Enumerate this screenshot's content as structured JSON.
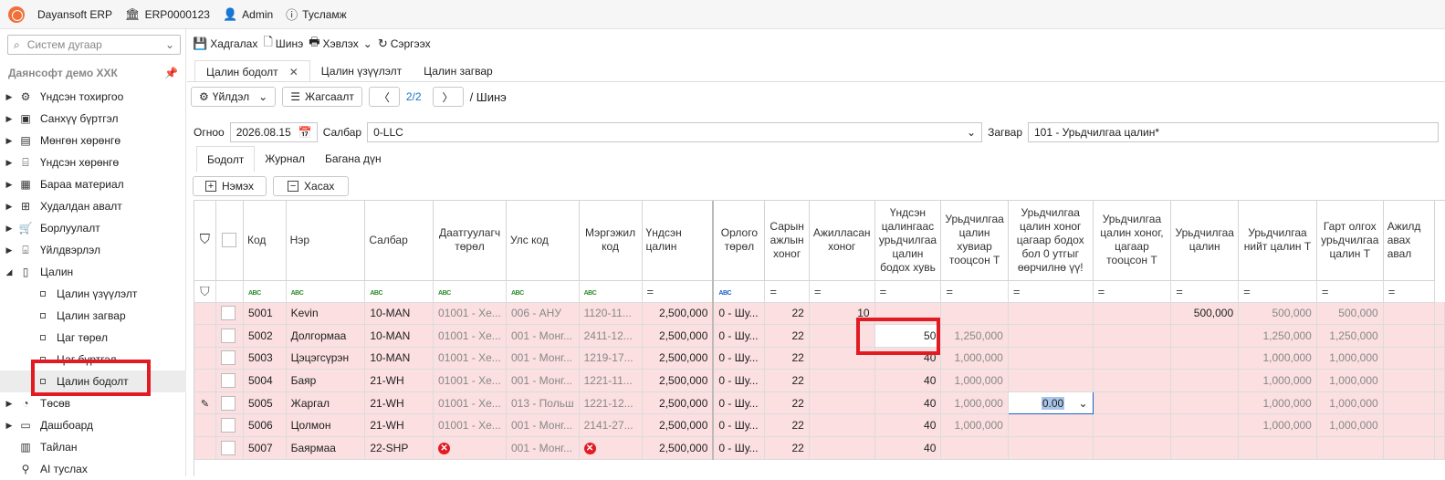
{
  "topbar": {
    "app": "Dayansoft ERP",
    "code": "ERP0000123",
    "user": "Admin",
    "help": "Тусламж"
  },
  "sidebar": {
    "search_placeholder": "Систем дугаар",
    "company": "Даянсофт демо ХХК",
    "items": [
      {
        "label": "Үндсэн тохиргоо",
        "icon": "gear-icon",
        "arrow": "▶"
      },
      {
        "label": "Санхүү бүртгэл",
        "icon": "ledger-icon",
        "arrow": "▶"
      },
      {
        "label": "Мөнгөн хөрөнгө",
        "icon": "cash-icon",
        "arrow": "▶"
      },
      {
        "label": "Үндсэн хөрөнгө",
        "icon": "asset-icon",
        "arrow": "▶"
      },
      {
        "label": "Бараа материал",
        "icon": "box-icon",
        "arrow": "▶"
      },
      {
        "label": "Худалдан авалт",
        "icon": "cart-icon",
        "arrow": "▶"
      },
      {
        "label": "Борлуулалт",
        "icon": "sales-icon",
        "arrow": "▶"
      },
      {
        "label": "Үйлдвэрлэл",
        "icon": "factory-icon",
        "arrow": "▶"
      },
      {
        "label": "Цалин",
        "icon": "document-icon",
        "arrow": "◢"
      }
    ],
    "sub_items": [
      "Цалин үзүүлэлт",
      "Цалин загвар",
      "Цаг төрөл",
      "Цаг бүртгэл",
      "Цалин бодолт"
    ],
    "bottom_items": [
      {
        "label": "Төсөв",
        "icon": "pie-icon",
        "arrow": "▶"
      },
      {
        "label": "Дашбоард",
        "icon": "dashboard-icon",
        "arrow": "▶"
      },
      {
        "label": "Тайлан",
        "icon": "report-icon",
        "arrow": ""
      },
      {
        "label": "AI туслах",
        "icon": "ai-icon",
        "arrow": ""
      }
    ]
  },
  "toolbar": {
    "save": "Хадгалах",
    "new": "Шинэ",
    "print": "Хэвлэх",
    "refresh": "Сэргээх"
  },
  "tabs": [
    "Цалин бодолт",
    "Цалин үзүүлэлт",
    "Цалин загвар"
  ],
  "nav": {
    "actions": "Үйлдэл",
    "list": "Жагсаалт",
    "page": "2/2",
    "crumb": "/ Шинэ"
  },
  "form": {
    "date_label": "Огноо",
    "date": "2026.08.15",
    "branch_label": "Салбар",
    "branch": "0-LLC",
    "template_label": "Загвар",
    "template": "101 - Урьдчилгаа цалин*"
  },
  "subtabs": [
    "Бодолт",
    "Журнал",
    "Багана дүн"
  ],
  "grid_actions": {
    "add": "Нэмэх",
    "remove": "Хасах"
  },
  "columns": [
    "Код",
    "Нэр",
    "Салбар",
    "Даатгуулагч төрөл",
    "Улс код",
    "Мэргэжил код",
    "Үндсэн цалин",
    "Орлого төрөл",
    "Сарын ажлын хоног",
    "Ажилласан хоног",
    "Үндсэн цалингаас урьдчилгаа цалин бодох хувь",
    "Урьдчилгаа цалин хувиар тооцсон Т",
    "Урьдчилгаа цалин хоног цагаар бодох бол 0 утгыг өөрчилнө үү!",
    "Урьдчилгаа цалин хоног, цагаар тооцсон Т",
    "Урьдчилгаа цалин",
    "Урьдчилгаа нийт цалин Т",
    "Гарт олгох урьдчилгаа цалин Т",
    "Ажилд авах авал"
  ],
  "filter_icon_text": "ABC",
  "filter_eq": "=",
  "rows": [
    {
      "code": "5001",
      "name": "Kevin",
      "branch": "10-MAN",
      "ins": "01001 - Хе...",
      "country": "006 - АНУ",
      "prof": "1120-11...",
      "base": "2,500,000",
      "income": "0 - Шу...",
      "days": "22",
      "worked": "10",
      "pct": "",
      "pctamt": "",
      "hours": "",
      "hoursamt": "",
      "adv": "500,000",
      "total": "500,000",
      "hand": "500,000",
      "hire": ""
    },
    {
      "code": "5002",
      "name": "Долгормаа",
      "branch": "10-MAN",
      "ins": "01001 - Хе...",
      "country": "001 - Монг...",
      "prof": "2411-12...",
      "base": "2,500,000",
      "income": "0 - Шу...",
      "days": "22",
      "worked": "",
      "pct": "50",
      "pctamt": "1,250,000",
      "hours": "",
      "hoursamt": "",
      "adv": "",
      "total": "1,250,000",
      "hand": "1,250,000",
      "hire": ""
    },
    {
      "code": "5003",
      "name": "Цэцэгсүрэн",
      "branch": "10-MAN",
      "ins": "01001 - Хе...",
      "country": "001 - Монг...",
      "prof": "1219-17...",
      "base": "2,500,000",
      "income": "0 - Шу...",
      "days": "22",
      "worked": "",
      "pct": "40",
      "pctamt": "1,000,000",
      "hours": "",
      "hoursamt": "",
      "adv": "",
      "total": "1,000,000",
      "hand": "1,000,000",
      "hire": ""
    },
    {
      "code": "5004",
      "name": "Баяр",
      "branch": "21-WH",
      "ins": "01001 - Хе...",
      "country": "001 - Монг...",
      "prof": "1221-11...",
      "base": "2,500,000",
      "income": "0 - Шу...",
      "days": "22",
      "worked": "",
      "pct": "40",
      "pctamt": "1,000,000",
      "hours": "",
      "hoursamt": "",
      "adv": "",
      "total": "1,000,000",
      "hand": "1,000,000",
      "hire": ""
    },
    {
      "code": "5005",
      "name": "Жаргал",
      "branch": "21-WH",
      "ins": "01001 - Хе...",
      "country": "013 - Польш",
      "prof": "1221-12...",
      "base": "2,500,000",
      "income": "0 - Шу...",
      "days": "22",
      "worked": "",
      "pct": "40",
      "pctamt": "1,000,000",
      "hours": "0.00",
      "hoursamt": "",
      "adv": "",
      "total": "1,000,000",
      "hand": "1,000,000",
      "hire": ""
    },
    {
      "code": "5006",
      "name": "Цолмон",
      "branch": "21-WH",
      "ins": "01001 - Хе...",
      "country": "001 - Монг...",
      "prof": "2141-27...",
      "base": "2,500,000",
      "income": "0 - Шу...",
      "days": "22",
      "worked": "",
      "pct": "40",
      "pctamt": "1,000,000",
      "hours": "",
      "hoursamt": "",
      "adv": "",
      "total": "1,000,000",
      "hand": "1,000,000",
      "hire": ""
    },
    {
      "code": "5007",
      "name": "Баярмаа",
      "branch": "22-SHP",
      "ins": "",
      "country": "001 - Монг...",
      "prof": "",
      "base": "2,500,000",
      "income": "0 - Шу...",
      "days": "22",
      "worked": "",
      "pct": "40",
      "pctamt": "",
      "hours": "",
      "hoursamt": "",
      "adv": "",
      "total": "",
      "hand": "",
      "hire": ""
    }
  ],
  "colors": {
    "row_bg": "#fbdfe1",
    "highlight": "#e21b23",
    "link": "#1a73c8",
    "logo": "#f0703a"
  }
}
